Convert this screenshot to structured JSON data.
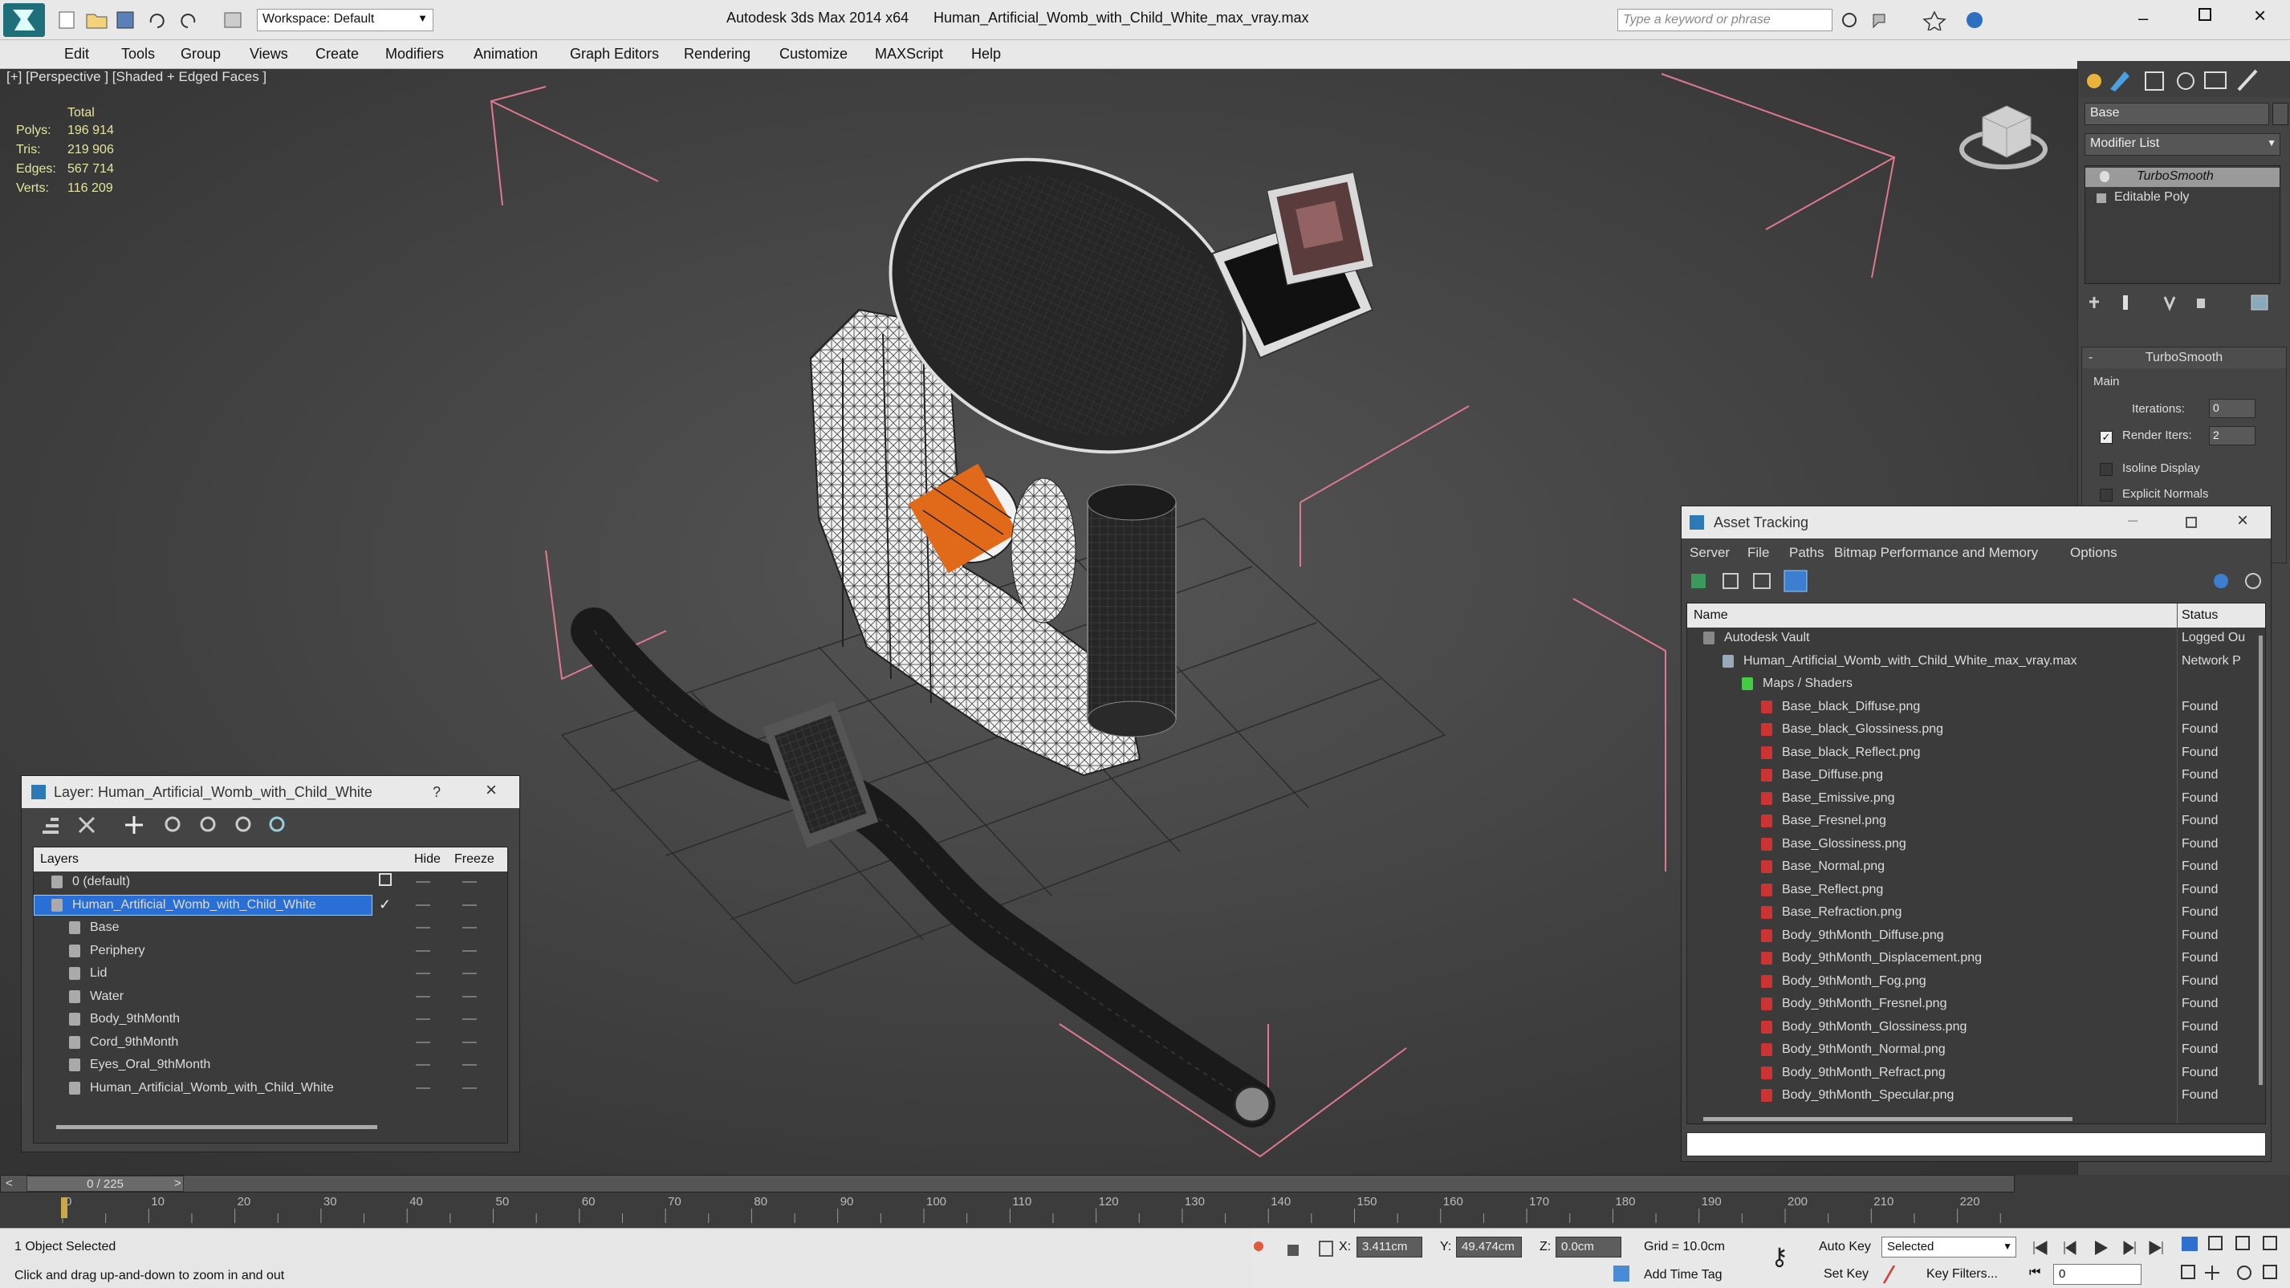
{
  "titlebar": {
    "app_title": "Autodesk 3ds Max  2014 x64",
    "file_name": "Human_Artificial_Womb_with_Child_White_max_vray.max",
    "workspace": "Workspace: Default",
    "search_placeholder": "Type a keyword or phrase"
  },
  "menu": [
    "Edit",
    "Tools",
    "Group",
    "Views",
    "Create",
    "Modifiers",
    "Animation",
    "Graph Editors",
    "Rendering",
    "Customize",
    "MAXScript",
    "Help"
  ],
  "viewport": {
    "label": "[+] [Perspective ] [Shaded + Edged Faces ]",
    "stats_header": "Total",
    "stats": [
      {
        "label": "Polys:",
        "value": "196 914"
      },
      {
        "label": "Tris:",
        "value": "219 906"
      },
      {
        "label": "Edges:",
        "value": "567 714"
      },
      {
        "label": "Verts:",
        "value": "116 209"
      }
    ]
  },
  "command_panel": {
    "object_name": "Base",
    "modifier_list": "Modifier List",
    "stack": [
      "TurboSmooth",
      "Editable Poly"
    ],
    "rollout_title": "TurboSmooth",
    "group_main": "Main",
    "iterations_label": "Iterations:",
    "iterations_value": "0",
    "render_iters_label": "Render Iters:",
    "render_iters_value": "2",
    "isoline_label": "Isoline Display",
    "explicit_normals_label": "Explicit Normals"
  },
  "layer_window": {
    "title": "Layer: Human_Artificial_Womb_with_Child_White",
    "help": "?",
    "col_layers": "Layers",
    "col_hide": "Hide",
    "col_freeze": "Freeze",
    "rows": [
      {
        "name": "0 (default)",
        "level": 0,
        "selected": false
      },
      {
        "name": "Human_Artificial_Womb_with_Child_White",
        "level": 0,
        "selected": true
      },
      {
        "name": "Base",
        "level": 1,
        "selected": false
      },
      {
        "name": "Periphery",
        "level": 1,
        "selected": false
      },
      {
        "name": "Lid",
        "level": 1,
        "selected": false
      },
      {
        "name": "Water",
        "level": 1,
        "selected": false
      },
      {
        "name": "Body_9thMonth",
        "level": 1,
        "selected": false
      },
      {
        "name": "Cord_9thMonth",
        "level": 1,
        "selected": false
      },
      {
        "name": "Eyes_Oral_9thMonth",
        "level": 1,
        "selected": false
      },
      {
        "name": "Human_Artificial_Womb_with_Child_White",
        "level": 1,
        "selected": false
      }
    ]
  },
  "asset_window": {
    "title": "Asset Tracking",
    "menu": [
      "Server",
      "File",
      "Paths",
      "Bitmap Performance and Memory",
      "Options"
    ],
    "col_name": "Name",
    "col_status": "Status",
    "rows": [
      {
        "name": "Autodesk Vault",
        "status": "Logged Ou",
        "level": 0
      },
      {
        "name": "Human_Artificial_Womb_with_Child_White_max_vray.max",
        "status": "Network P",
        "level": 1
      },
      {
        "name": "Maps / Shaders",
        "status": "",
        "level": 2
      },
      {
        "name": "Base_black_Diffuse.png",
        "status": "Found",
        "level": 3
      },
      {
        "name": "Base_black_Glossiness.png",
        "status": "Found",
        "level": 3
      },
      {
        "name": "Base_black_Reflect.png",
        "status": "Found",
        "level": 3
      },
      {
        "name": "Base_Diffuse.png",
        "status": "Found",
        "level": 3
      },
      {
        "name": "Base_Emissive.png",
        "status": "Found",
        "level": 3
      },
      {
        "name": "Base_Fresnel.png",
        "status": "Found",
        "level": 3
      },
      {
        "name": "Base_Glossiness.png",
        "status": "Found",
        "level": 3
      },
      {
        "name": "Base_Normal.png",
        "status": "Found",
        "level": 3
      },
      {
        "name": "Base_Reflect.png",
        "status": "Found",
        "level": 3
      },
      {
        "name": "Base_Refraction.png",
        "status": "Found",
        "level": 3
      },
      {
        "name": "Body_9thMonth_Diffuse.png",
        "status": "Found",
        "level": 3
      },
      {
        "name": "Body_9thMonth_Displacement.png",
        "status": "Found",
        "level": 3
      },
      {
        "name": "Body_9thMonth_Fog.png",
        "status": "Found",
        "level": 3
      },
      {
        "name": "Body_9thMonth_Fresnel.png",
        "status": "Found",
        "level": 3
      },
      {
        "name": "Body_9thMonth_Glossiness.png",
        "status": "Found",
        "level": 3
      },
      {
        "name": "Body_9thMonth_Normal.png",
        "status": "Found",
        "level": 3
      },
      {
        "name": "Body_9thMonth_Refract.png",
        "status": "Found",
        "level": 3
      },
      {
        "name": "Body_9thMonth_Specular.png",
        "status": "Found",
        "level": 3
      }
    ]
  },
  "timeline": {
    "frame_counter": "0 / 225",
    "ticks": [
      "0",
      "10",
      "20",
      "30",
      "40",
      "50",
      "60",
      "70",
      "80",
      "90",
      "100",
      "110",
      "120",
      "130",
      "140",
      "150",
      "160",
      "170",
      "180",
      "190",
      "200",
      "210",
      "220"
    ]
  },
  "status": {
    "selected": "1 Object Selected",
    "hint": "Click and drag up-and-down to zoom in and out",
    "x_label": "X:",
    "x_value": "3.411cm",
    "y_label": "Y:",
    "y_value": "49.474cm",
    "z_label": "Z:",
    "z_value": "0.0cm",
    "grid": "Grid = 10.0cm",
    "add_time_tag": "Add Time Tag",
    "auto_key": "Auto Key",
    "set_key": "Set Key",
    "selected_dropdown": "Selected",
    "key_filters": "Key Filters...",
    "frame_value": "0"
  }
}
